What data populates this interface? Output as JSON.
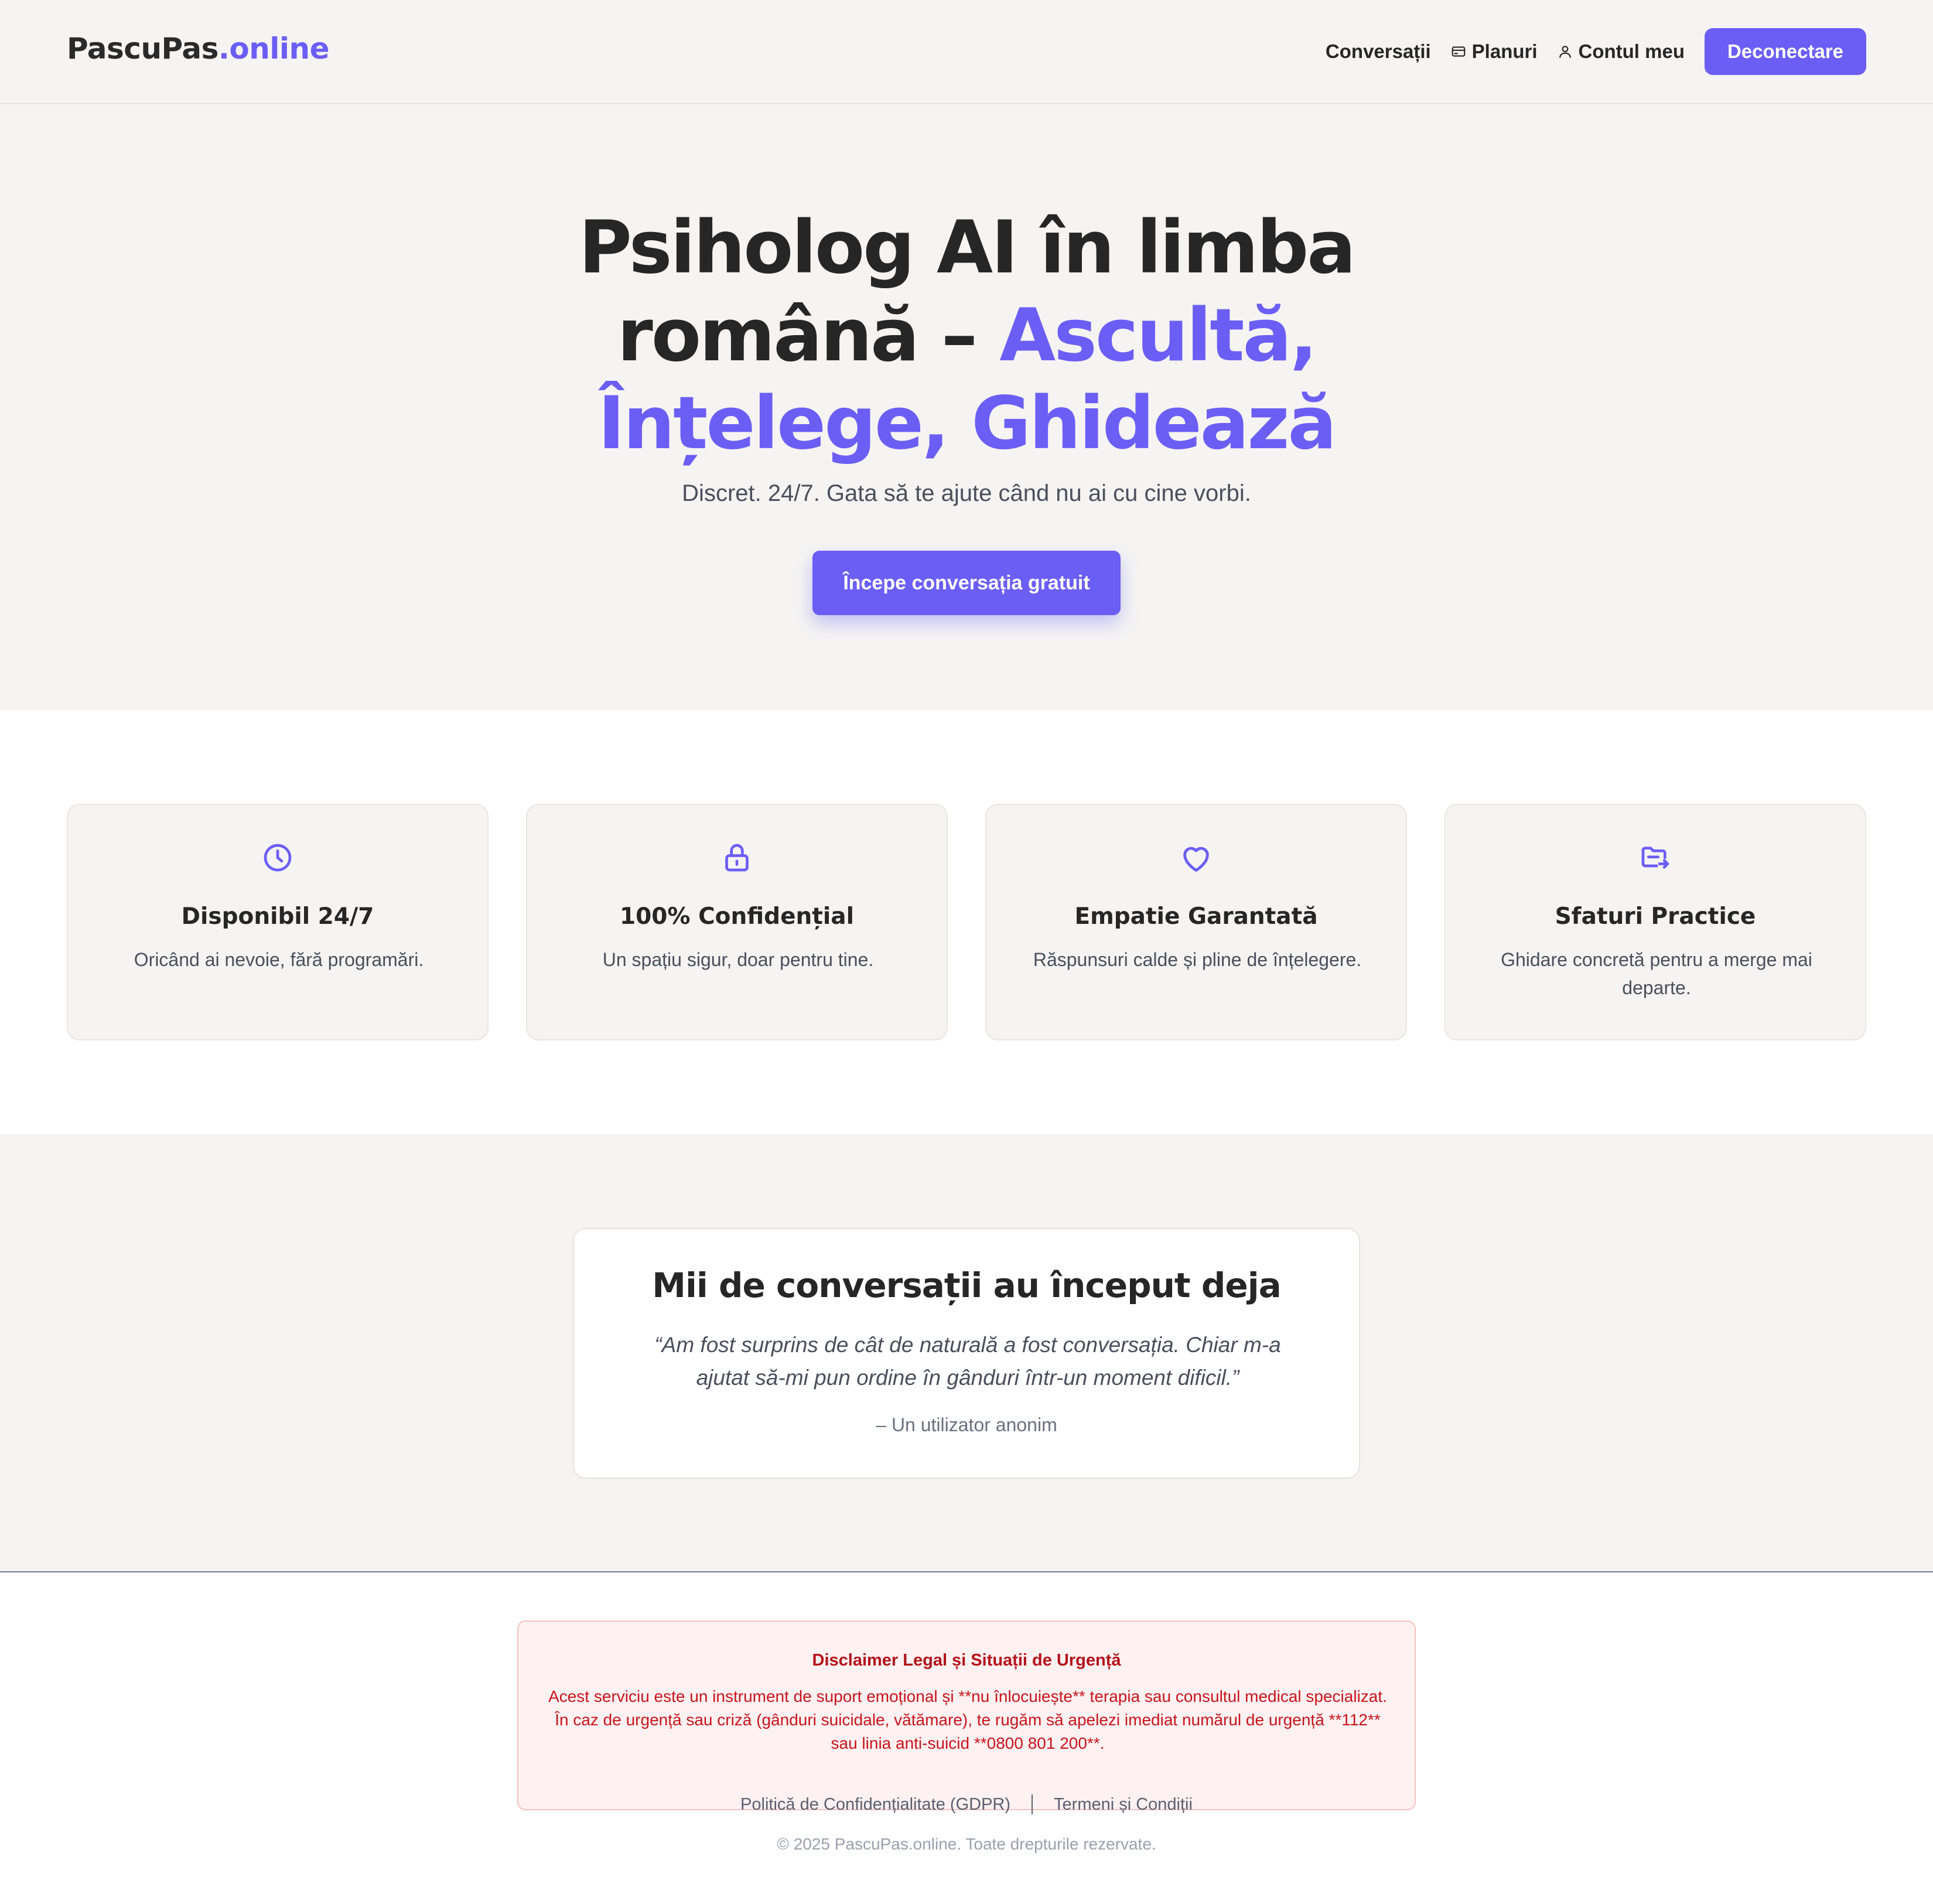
{
  "header": {
    "logo_main": "PascuPas",
    "logo_accent": ".online",
    "nav": {
      "conversations": "Conversații",
      "plans": "Planuri",
      "account": "Contul meu"
    },
    "logout_label": "Deconectare"
  },
  "hero": {
    "title_part1": "Psiholog AI în limba română – ",
    "title_accent": "Ascultă, Înțelege, Ghidează",
    "subtitle": "Discret. 24/7. Gata să te ajute când nu ai cu cine vorbi.",
    "cta_label": "Începe conversația gratuit"
  },
  "features": [
    {
      "icon": "clock-icon",
      "title": "Disponibil 24/7",
      "desc": "Oricând ai nevoie, fără programări."
    },
    {
      "icon": "lock-icon",
      "title": "100% Confidențial",
      "desc": "Un spațiu sigur, doar pentru tine."
    },
    {
      "icon": "heart-icon",
      "title": "Empatie Garantată",
      "desc": "Răspunsuri calde și pline de înțelegere."
    },
    {
      "icon": "folder-arrow-icon",
      "title": "Sfaturi Practice",
      "desc": "Ghidare concretă pentru a merge mai departe."
    }
  ],
  "testimonial": {
    "heading": "Mii de conversații au început deja",
    "quote": "“Am fost surprins de cât de naturală a fost conversația. Chiar m-a ajutat să-mi pun ordine în gânduri într-un moment dificil.”",
    "author": "– Un utilizator anonim"
  },
  "footer": {
    "disclaimer_title": "Disclaimer Legal și Situații de Urgență",
    "disclaimer_body": "Acest serviciu este un instrument de suport emoțional și **nu înlocuiește** terapia sau consultul medical specializat. În caz de urgență sau criză (gânduri suicidale, vătămare), te rugăm să apelezi imediat numărul de urgență **112** sau linia anti-suicid **0800 801 200**.",
    "link_privacy": "Politică de Confidențialitate (GDPR)",
    "link_terms": "Termeni și Condiții",
    "copyright": "© 2025 PascuPas.online. Toate drepturile rezervate."
  },
  "colors": {
    "accent": "#6b5ef5",
    "background_muted": "#f5f4f3",
    "danger": "#c8141c"
  }
}
